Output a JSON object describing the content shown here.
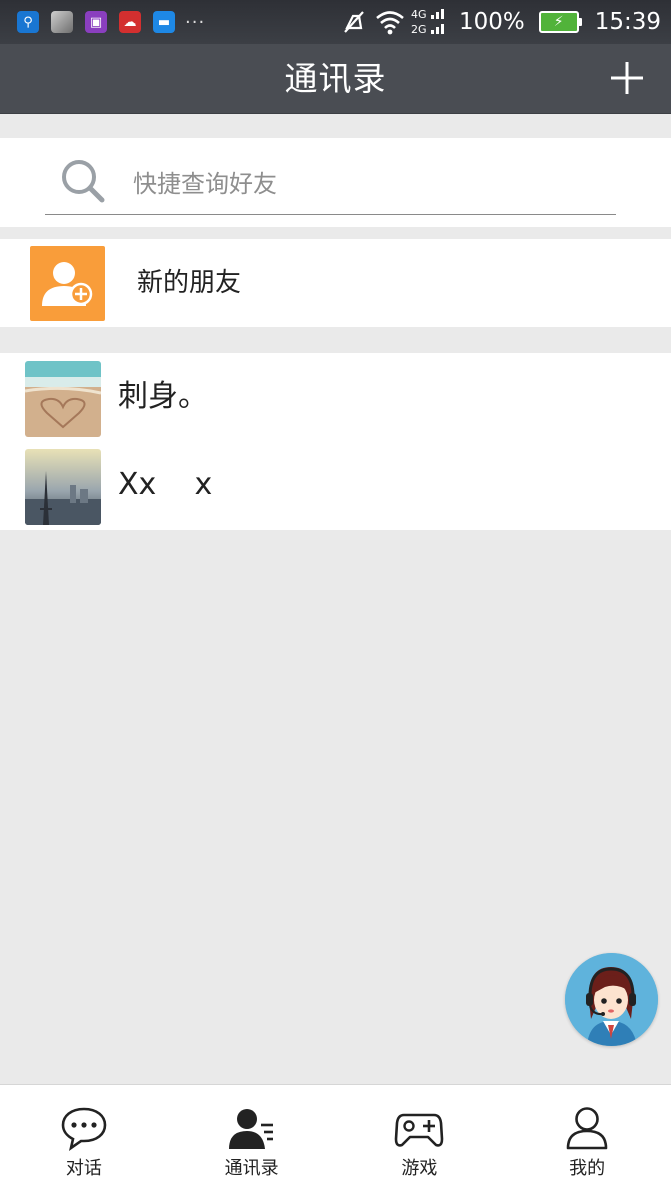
{
  "status_bar": {
    "notification_icons": [
      "usb-icon",
      "photo-thumbnail-icon",
      "gallery-icon",
      "cloud-icon",
      "message-icon"
    ],
    "more": "···",
    "battery": "100%",
    "time": "15:39",
    "network_4g": "4G",
    "network_2g": "2G"
  },
  "header": {
    "title": "通讯录",
    "add_icon": "plus-icon"
  },
  "search": {
    "placeholder": "快捷查询好友",
    "value": ""
  },
  "new_friends": {
    "label": "新的朋友",
    "icon": "add-contact-icon",
    "color": "#f99d3a"
  },
  "contacts": [
    {
      "name": "刺身。",
      "avatar": "beach-heart-avatar"
    },
    {
      "name": "Xx    x",
      "avatar": "paris-eiffel-avatar"
    }
  ],
  "support": {
    "icon": "customer-service-avatar"
  },
  "bottom_nav": [
    {
      "label": "对话",
      "icon": "chat-bubble-icon"
    },
    {
      "label": "通讯录",
      "icon": "contacts-icon"
    },
    {
      "label": "游戏",
      "icon": "gamepad-icon"
    },
    {
      "label": "我的",
      "icon": "profile-icon"
    }
  ],
  "colors": {
    "header_bg": "#4a4d53",
    "page_bg": "#eaeaea",
    "accent_orange": "#f99d3a"
  }
}
